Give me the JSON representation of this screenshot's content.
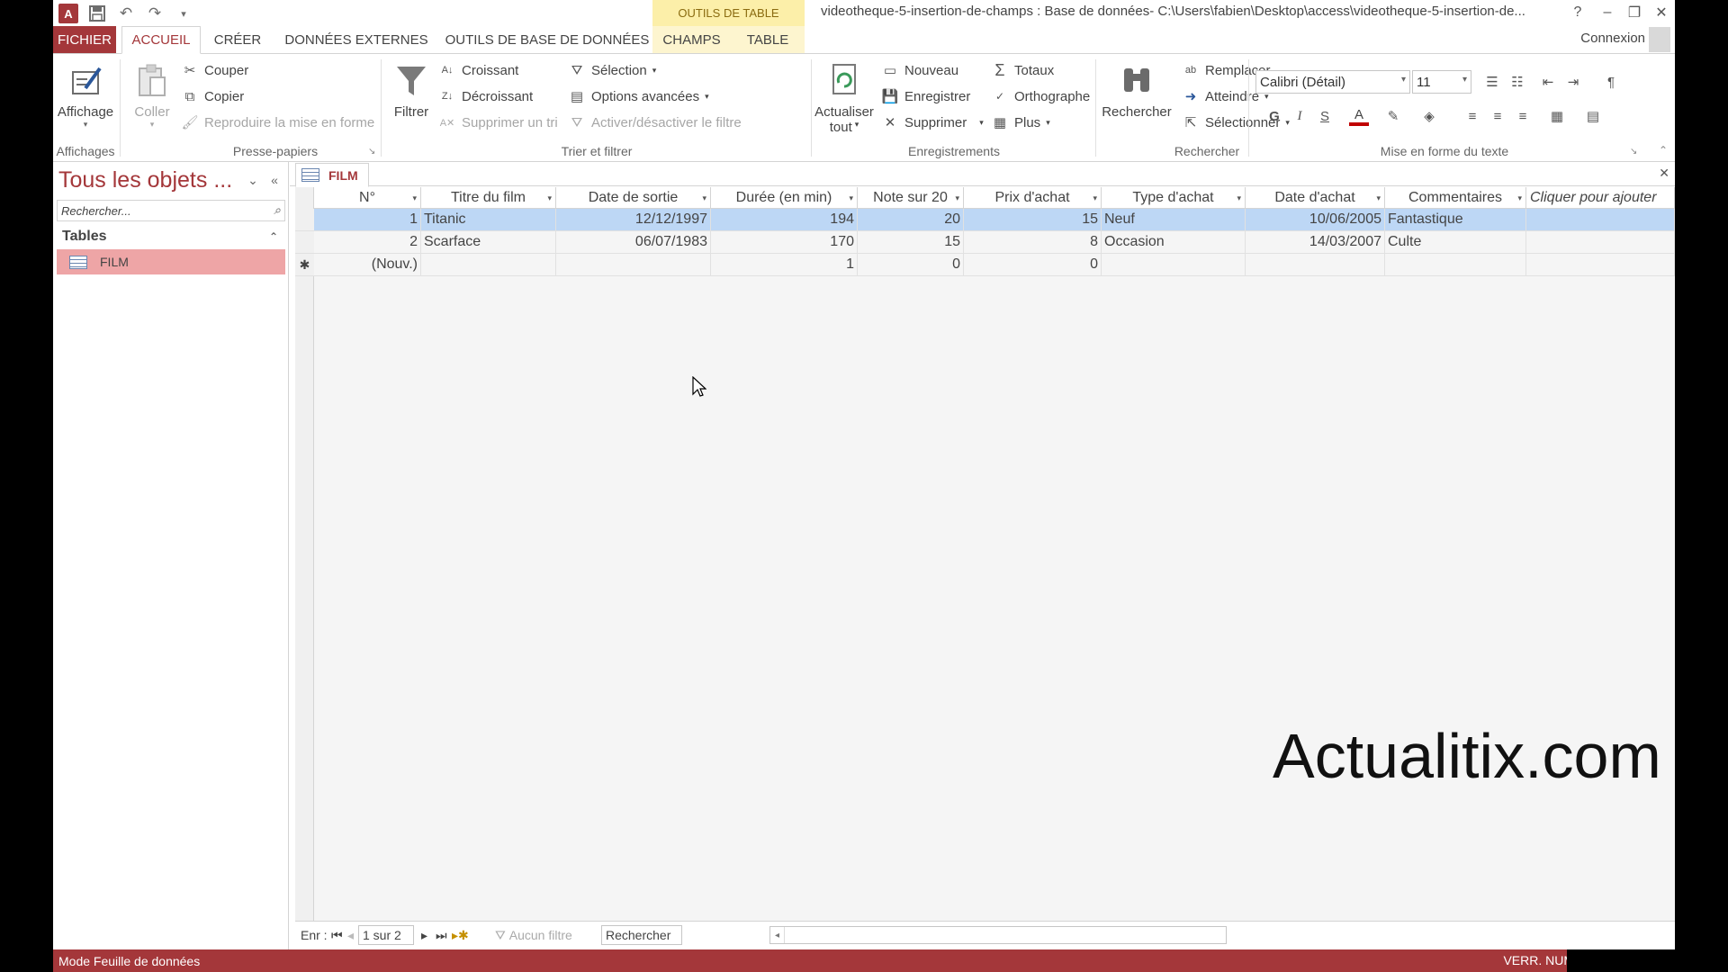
{
  "window": {
    "title": "videotheque-5-insertion-de-champs : Base de données- C:\\Users\\fabien\\Desktop\\access\\videotheque-5-insertion-de...",
    "context_header": "OUTILS DE TABLE",
    "help": "?",
    "accent": "#a4373a"
  },
  "tabs": {
    "fichier": "FICHIER",
    "accueil": "ACCUEIL",
    "creer": "CRÉER",
    "donnees_externes": "DONNÉES EXTERNES",
    "outils_bd": "OUTILS DE BASE DE DONNÉES",
    "champs": "CHAMPS",
    "table": "TABLE"
  },
  "connexion": "Connexion",
  "ribbon": {
    "affichage": "Affichage",
    "affichages_group": "Affichages",
    "coller": "Coller",
    "couper": "Couper",
    "copier": "Copier",
    "reproduire": "Reproduire la mise en forme",
    "presse_papiers_group": "Presse-papiers",
    "filtrer": "Filtrer",
    "croissant": "Croissant",
    "decroissant": "Décroissant",
    "supprimer_tri": "Supprimer un tri",
    "selection": "Sélection",
    "options_avancees": "Options avancées",
    "activer_filtre": "Activer/désactiver le filtre",
    "trier_filtrer_group": "Trier et filtrer",
    "actualiser": "Actualiser",
    "tout": "tout",
    "nouveau": "Nouveau",
    "enregistrer": "Enregistrer",
    "supprimer": "Supprimer",
    "totaux": "Totaux",
    "orthographe": "Orthographe",
    "plus": "Plus",
    "enregistrements_group": "Enregistrements",
    "rechercher": "Rechercher",
    "remplacer": "Remplacer",
    "atteindre": "Atteindre",
    "selectionner": "Sélectionner",
    "rechercher_group": "Rechercher",
    "font_name": "Calibri (Détail)",
    "font_size": "11",
    "bold": "G",
    "italic": "I",
    "underline": "S",
    "mise_en_forme_group": "Mise en forme du texte"
  },
  "nav": {
    "title": "Tous les objets ...",
    "search_placeholder": "Rechercher...",
    "section": "Tables",
    "items": [
      {
        "label": "FILM"
      }
    ]
  },
  "document": {
    "tab_label": "FILM"
  },
  "table": {
    "columns": [
      "N°",
      "Titre du film",
      "Date de sortie",
      "Durée (en min)",
      "Note sur 20",
      "Prix d'achat",
      "Type d'achat",
      "Date d'achat",
      "Commentaires",
      "Cliquer pour ajouter"
    ],
    "rows": [
      [
        "1",
        "Titanic",
        "12/12/1997",
        "194",
        "20",
        "15",
        "Neuf",
        "10/06/2005",
        "Fantastique",
        ""
      ],
      [
        "2",
        "Scarface",
        "06/07/1983",
        "170",
        "15",
        "8",
        "Occasion",
        "14/03/2007",
        "Culte",
        ""
      ]
    ],
    "new_row": [
      "(Nouv.)",
      "",
      "",
      "1",
      "0",
      "0",
      "",
      "",
      "",
      ""
    ],
    "new_row_marker": "✱",
    "selected_row_color": "#bdd7f5"
  },
  "record_nav": {
    "label": "Enr :",
    "position": "1 sur 2",
    "filter": "Aucun filtre",
    "search": "Rechercher"
  },
  "status": {
    "mode": "Mode Feuille de données",
    "indicators": "VERR. NUM"
  },
  "watermark": "Actualitix.com"
}
